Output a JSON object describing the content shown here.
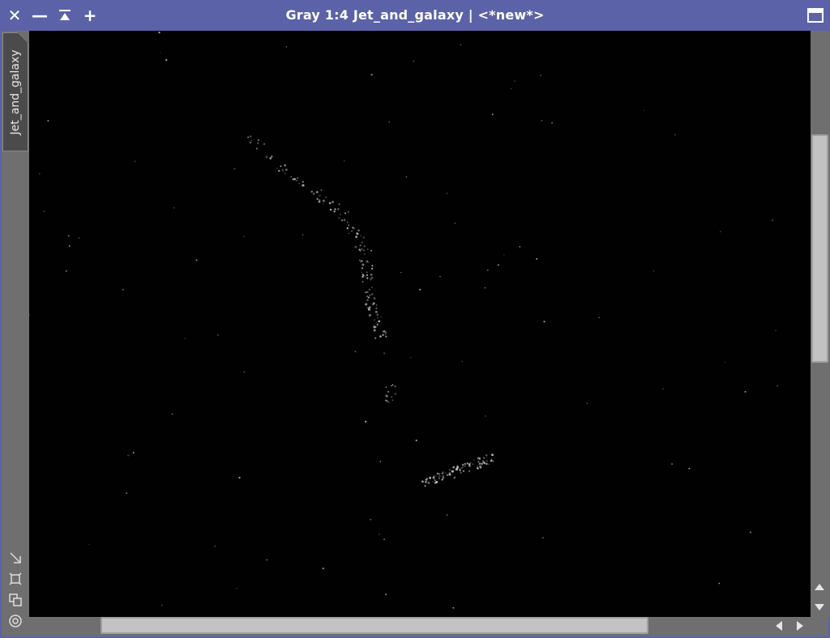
{
  "window": {
    "title": "Gray 1:4 Jet_and_galaxy | <*new*>",
    "close_glyph": "✕",
    "minimize_glyph": "—",
    "shade_glyph": "⌅",
    "add_glyph": "+"
  },
  "side_tab": {
    "label": "Jet_and_galaxy"
  },
  "left_tools": [
    {
      "name": "zoom-to-fit-icon"
    },
    {
      "name": "fit-view-icon"
    },
    {
      "name": "clone-view-icon"
    },
    {
      "name": "target-icon"
    }
  ],
  "image": {
    "background": "#010101",
    "foreground": "#e0e0e0"
  },
  "scrollbars": {
    "vertical": {
      "position_fraction": 0.18,
      "visible_fraction": 0.39
    },
    "horizontal": {
      "position_fraction": 0.09,
      "visible_fraction": 0.7
    }
  },
  "colors": {
    "titlebar": "#5b62a8",
    "frame": "#6f6f6f",
    "scroll_thumb": "#c2c2c2"
  }
}
